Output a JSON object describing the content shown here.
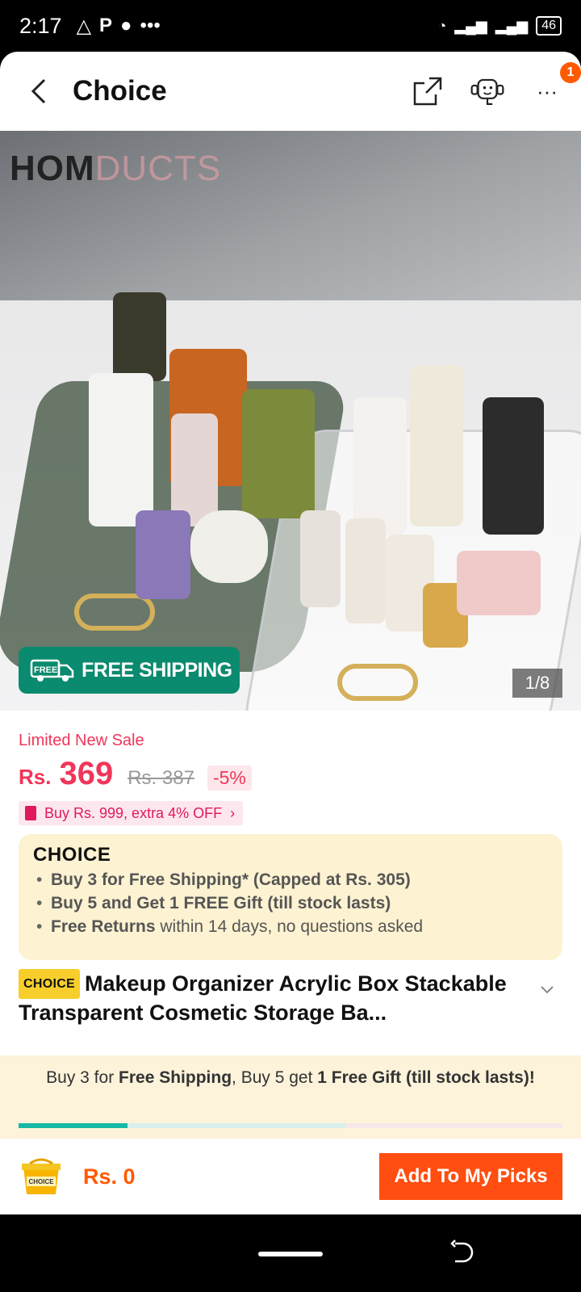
{
  "status_bar": {
    "time": "2:17",
    "battery": "46"
  },
  "header": {
    "title": "Choice",
    "notification_count": "1"
  },
  "image": {
    "watermark_dark": "HOM",
    "watermark_light": "DUCTS",
    "free_shipping": "FREE SHIPPING",
    "free_icon_text": "FREE",
    "counter": "1/8"
  },
  "pricing": {
    "sale_label": "Limited New Sale",
    "currency": "Rs.",
    "price": "369",
    "original_price": "Rs. 387",
    "discount": "-5%",
    "coupon": "Buy Rs. 999, extra 4% OFF"
  },
  "choice": {
    "logo": "CHOICE",
    "benefits": [
      {
        "bold": "Buy 3 for  Free Shipping* (Capped at Rs. 305)",
        "rest": ""
      },
      {
        "bold": "Buy 5 and Get 1 FREE Gift (till stock lasts)",
        "rest": ""
      },
      {
        "bold": "Free Returns",
        "rest": " within 14 days, no questions asked"
      }
    ]
  },
  "product": {
    "tag": "CHOICE",
    "title": "Makeup Organizer Acrylic Box Stackable Transparent Cosmetic Storage Ba..."
  },
  "promo": {
    "part1": "Buy 3 for ",
    "bold1": "Free Shipping",
    "part2": ", Buy 5 get ",
    "bold2": "1 Free Gift (till stock lasts)!",
    "progress": 0.2
  },
  "bottom_bar": {
    "cart_label": "CHOICE",
    "total": "Rs. 0",
    "button": "Add To My Picks"
  },
  "colors": {
    "accent": "#ff4e0f",
    "price": "#f0355a",
    "free_shipping": "#0a8a6e",
    "choice_bg": "#fdf2d1"
  }
}
